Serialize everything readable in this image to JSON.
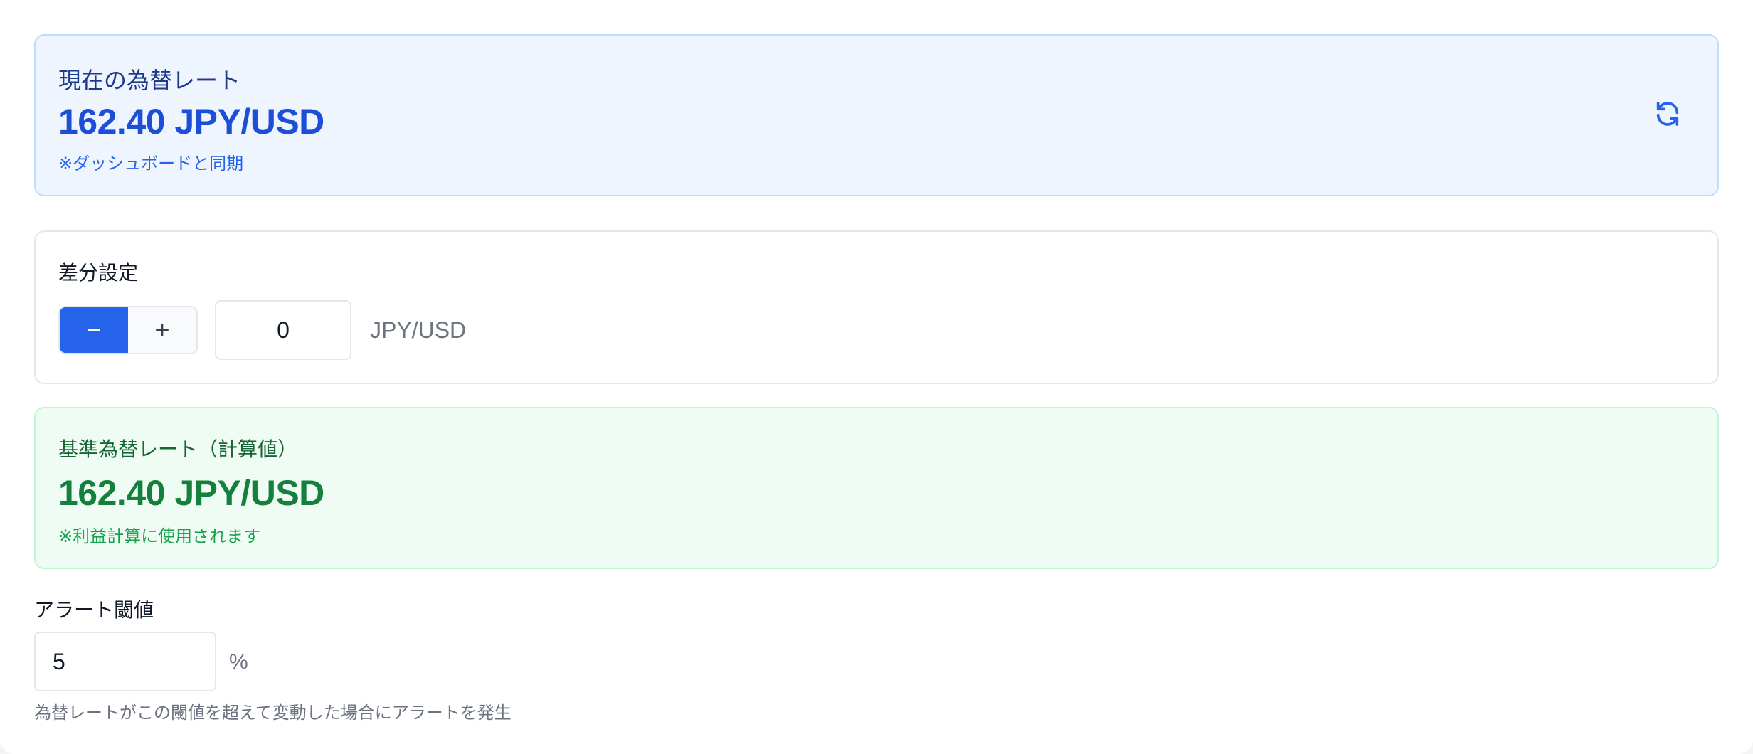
{
  "current_rate": {
    "title": "現在の為替レート",
    "value": "162.40 JPY/USD",
    "note": "※ダッシュボードと同期",
    "refresh_icon": "refresh-icon"
  },
  "difference": {
    "title": "差分設定",
    "minus_label": "−",
    "plus_label": "+",
    "value": "0",
    "unit": "JPY/USD",
    "selected_sign": "minus"
  },
  "base_rate": {
    "title": "基準為替レート（計算値）",
    "value": "162.40 JPY/USD",
    "note": "※利益計算に使用されます"
  },
  "alert": {
    "label": "アラート閾値",
    "value": "5",
    "unit": "%",
    "help": "為替レートがこの閾値を超えて変動した場合にアラートを発生"
  },
  "colors": {
    "accent": "#2563eb",
    "current_rate_bg": "#eef5ff",
    "base_rate_bg": "#eefcf3",
    "base_rate_text": "#15803d"
  }
}
